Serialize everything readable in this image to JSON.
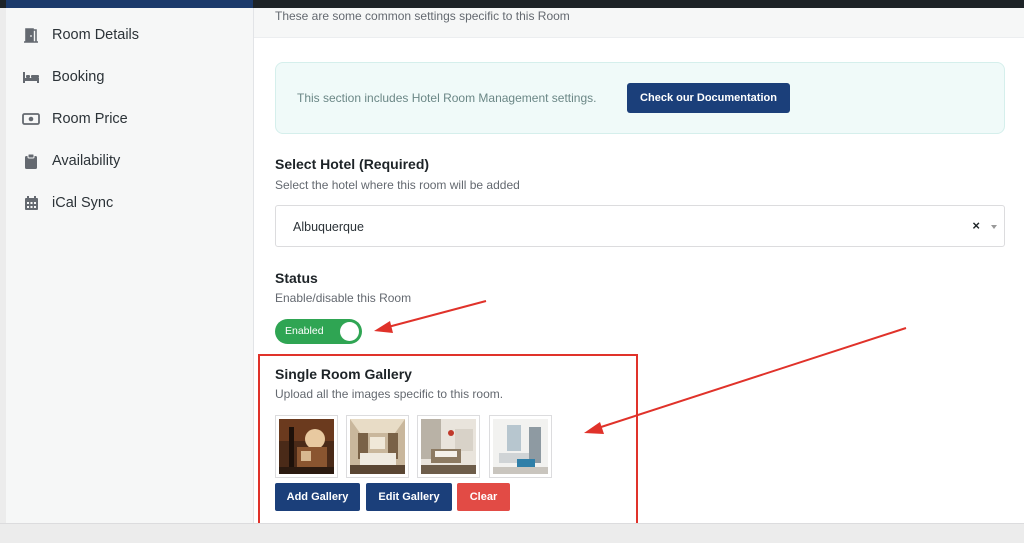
{
  "sidebar": {
    "items": [
      {
        "label": "Room Details",
        "icon": "door-icon"
      },
      {
        "label": "Booking",
        "icon": "bed-icon"
      },
      {
        "label": "Room Price",
        "icon": "money-icon"
      },
      {
        "label": "Availability",
        "icon": "clipboard-icon"
      },
      {
        "label": "iCal Sync",
        "icon": "calendar-icon"
      }
    ]
  },
  "header": {
    "subtitle": "These are some common settings specific to this Room"
  },
  "notice": {
    "text": "This section includes Hotel Room Management settings.",
    "button_label": "Check our Documentation"
  },
  "hotel": {
    "label": "Select Hotel (Required)",
    "description": "Select the hotel where this room will be added",
    "selected": "Albuquerque",
    "clear": "×"
  },
  "status": {
    "label": "Status",
    "description": "Enable/disable this Room",
    "toggle_label": "Enabled",
    "enabled": true
  },
  "gallery": {
    "label": "Single Room Gallery",
    "description": "Upload all the images specific to this room.",
    "images": [
      "room-photo-1",
      "room-photo-2",
      "room-photo-3",
      "room-photo-4"
    ],
    "buttons": {
      "add": "Add Gallery",
      "edit": "Edit Gallery",
      "clear": "Clear"
    }
  },
  "colors": {
    "primary": "#1b3f7a",
    "success": "#2fa553",
    "danger": "#e24b45",
    "annotation": "#e0322a"
  }
}
